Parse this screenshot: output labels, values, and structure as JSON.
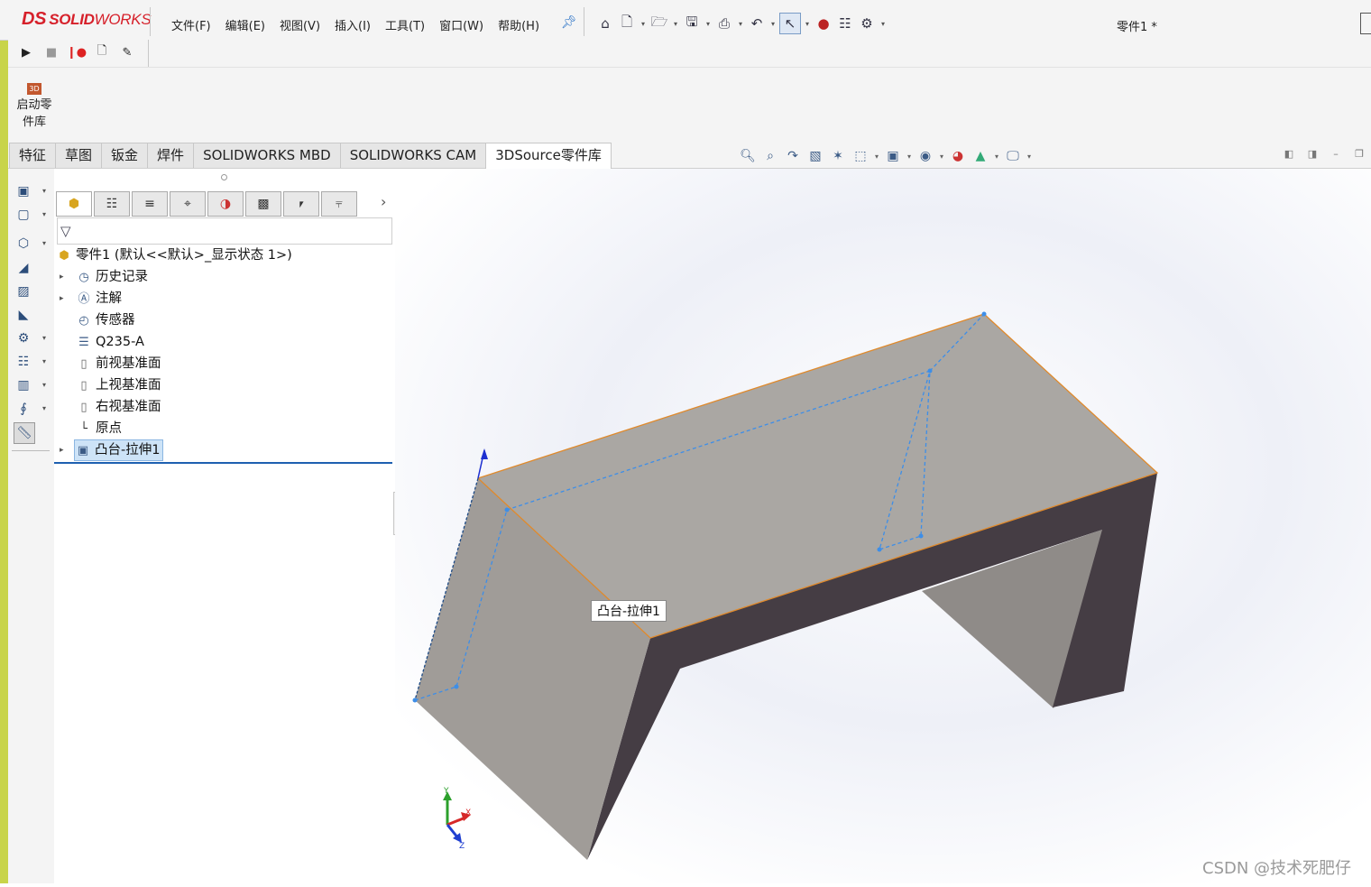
{
  "app": {
    "logo_ds": "DS",
    "logo_text_bold": "SOLID",
    "logo_text_rest": "WORKS",
    "document_title": "零件1 *"
  },
  "menu": [
    "文件(F)",
    "编辑(E)",
    "视图(V)",
    "插入(I)",
    "工具(T)",
    "窗口(W)",
    "帮助(H)"
  ],
  "quick_toolbar": [
    "home-icon",
    "new-document-icon",
    "open-icon",
    "save-icon",
    "print-icon",
    "undo-icon",
    "select-icon",
    "rebuild-icon",
    "file-properties-icon",
    "options-icon"
  ],
  "macro_toolbar": [
    "run-macro-icon",
    "stop-macro-icon",
    "record-macro-icon",
    "new-macro-icon",
    "edit-macro-icon"
  ],
  "command_manager": {
    "start_library_label": "启动零件库",
    "start_library_icon_text": "3D"
  },
  "tabs": [
    "特征",
    "草图",
    "钣金",
    "焊件",
    "SOLIDWORKS MBD",
    "SOLIDWORKS CAM",
    "3DSource零件库"
  ],
  "active_tab": "3DSource零件库",
  "view_toolbar": [
    "zoom-to-fit-icon",
    "zoom-to-area-icon",
    "previous-view-icon",
    "section-view-icon",
    "dynamic-annotation-icon",
    "view-orientation-icon",
    "display-style-icon",
    "hide-show-icon",
    "edit-appearance-icon",
    "apply-scene-icon",
    "view-settings-icon"
  ],
  "feature_manager": {
    "panel_tabs": [
      "feature-manager-icon",
      "property-manager-icon",
      "configuration-manager-icon",
      "dimxpert-icon",
      "display-manager-icon",
      "cam-feature-icon",
      "cam-operation-icon",
      "cam-tool-icon"
    ],
    "tree": [
      {
        "label": "零件1 (默认<<默认>_显示状态 1>)",
        "icon": "part-icon",
        "expandable": false
      },
      {
        "label": "历史记录",
        "icon": "history-icon",
        "expandable": true
      },
      {
        "label": "注解",
        "icon": "annotations-icon",
        "expandable": true
      },
      {
        "label": "传感器",
        "icon": "sensors-icon",
        "expandable": false
      },
      {
        "label": "Q235-A",
        "icon": "material-icon",
        "expandable": false
      },
      {
        "label": "前视基准面",
        "icon": "plane-icon",
        "expandable": false
      },
      {
        "label": "上视基准面",
        "icon": "plane-icon",
        "expandable": false
      },
      {
        "label": "右视基准面",
        "icon": "plane-icon",
        "expandable": false
      },
      {
        "label": "原点",
        "icon": "origin-icon",
        "expandable": false
      },
      {
        "label": "凸台-拉伸1",
        "icon": "boss-extrude-icon",
        "expandable": true,
        "selected": true
      }
    ]
  },
  "viewport": {
    "tooltip": "凸台-拉伸1",
    "triad_labels": [
      "Y",
      "X",
      "Z"
    ]
  },
  "watermark": "CSDN @技术死肥仔",
  "colors": {
    "top_face": "#aaa7a3",
    "side_face": "#a09c98",
    "dark_face": "#453d44",
    "edge_highlight": "#e08a2c",
    "sketch_dash": "#3d8ee8",
    "selection_bg": "#cde3f7"
  }
}
